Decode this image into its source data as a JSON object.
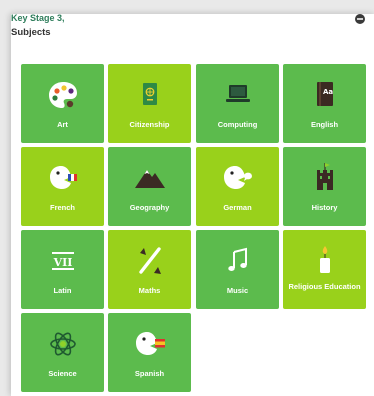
{
  "header": {
    "breadcrumb": "Key Stage 3,",
    "title": "Subjects"
  },
  "subjects": [
    {
      "label": "Art",
      "icon": "palette-icon"
    },
    {
      "label": "Citizenship",
      "icon": "passport-icon"
    },
    {
      "label": "Computing",
      "icon": "laptop-icon"
    },
    {
      "label": "English",
      "icon": "book-icon"
    },
    {
      "label": "French",
      "icon": "face-french-flag-icon"
    },
    {
      "label": "Geography",
      "icon": "mountain-icon"
    },
    {
      "label": "German",
      "icon": "face-speech-icon"
    },
    {
      "label": "History",
      "icon": "castle-icon"
    },
    {
      "label": "Latin",
      "icon": "roman-numeral-icon"
    },
    {
      "label": "Maths",
      "icon": "percent-icon"
    },
    {
      "label": "Music",
      "icon": "music-note-icon"
    },
    {
      "label": "Religious Education",
      "icon": "candle-icon"
    },
    {
      "label": "Science",
      "icon": "atom-icon"
    },
    {
      "label": "Spanish",
      "icon": "face-spanish-flag-icon"
    }
  ],
  "colors": {
    "tile_dark": "#5cbb4d",
    "tile_light": "#99d11b",
    "accent_text": "#2e7d5b"
  }
}
